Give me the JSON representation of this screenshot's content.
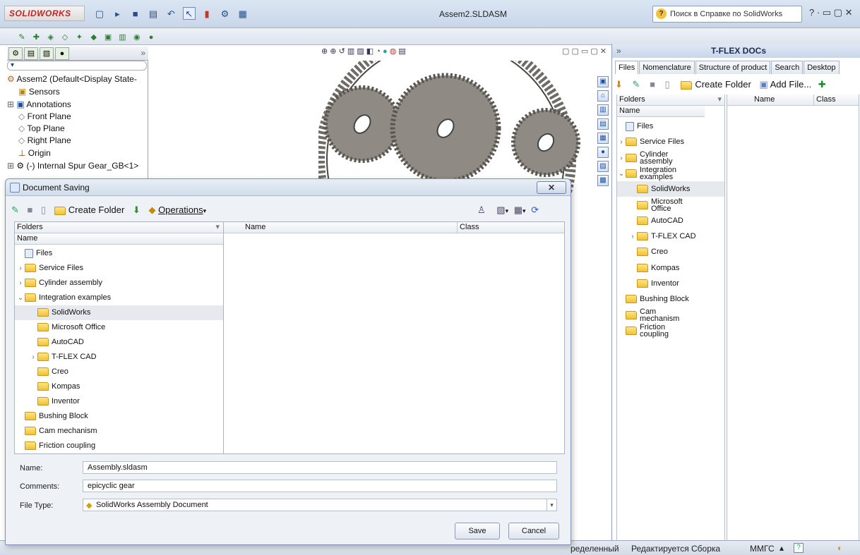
{
  "app": {
    "logo": "SOLIDWORKS",
    "document_title": "Assem2.SLDASM",
    "help_search_placeholder": "Поиск в Справке по SolidWorks",
    "window_controls": "? · ▭ ▢ ✕"
  },
  "toolbar": {
    "icons": [
      "new-icon",
      "open-icon",
      "save-icon",
      "print-icon",
      "undo-icon",
      "select-icon",
      "rebuild-icon",
      "options-icon",
      "view-icon"
    ],
    "row2_icons": [
      "mate-icon",
      "component-icon",
      "pattern-icon",
      "move-icon",
      "explode-icon",
      "assembly-feature-icon",
      "reference-icon",
      "bom-icon",
      "snapshot-icon",
      "check-icon"
    ]
  },
  "tree": {
    "root": "Assem2  (Default<Display State-",
    "items": [
      {
        "label": "Sensors",
        "icon": "sensor-icon"
      },
      {
        "label": "Annotations",
        "icon": "annotation-icon"
      },
      {
        "label": "Front Plane",
        "icon": "plane-icon"
      },
      {
        "label": "Top Plane",
        "icon": "plane-icon"
      },
      {
        "label": "Right Plane",
        "icon": "plane-icon"
      },
      {
        "label": "Origin",
        "icon": "origin-icon"
      },
      {
        "label": "(-) Internal Spur Gear_GB<1>",
        "icon": "part-icon"
      }
    ]
  },
  "dialog": {
    "title": "Document Saving",
    "close": "✕",
    "toolbar": {
      "create_folder": "Create Folder",
      "operations": "Operations"
    },
    "folders_header": "Folders",
    "name_header": "Name",
    "list_headers": {
      "name": "Name",
      "class": "Class"
    },
    "folders": [
      {
        "label": "Files",
        "level": 0,
        "expander": "",
        "root": true
      },
      {
        "label": "Service Files",
        "level": 0,
        "expander": "›"
      },
      {
        "label": "Cylinder assembly",
        "level": 0,
        "expander": "›"
      },
      {
        "label": "Integration examples",
        "level": 0,
        "expander": "⌄"
      },
      {
        "label": "SolidWorks",
        "level": 1,
        "expander": "",
        "selected": true
      },
      {
        "label": "Microsoft Office",
        "level": 1,
        "expander": ""
      },
      {
        "label": "AutoCAD",
        "level": 1,
        "expander": ""
      },
      {
        "label": "T-FLEX CAD",
        "level": 1,
        "expander": "›"
      },
      {
        "label": "Creo",
        "level": 1,
        "expander": ""
      },
      {
        "label": "Kompas",
        "level": 1,
        "expander": ""
      },
      {
        "label": "Inventor",
        "level": 1,
        "expander": ""
      },
      {
        "label": "Bushing Block",
        "level": 0,
        "expander": ""
      },
      {
        "label": "Cam mechanism",
        "level": 0,
        "expander": ""
      },
      {
        "label": "Friction coupling",
        "level": 0,
        "expander": ""
      }
    ],
    "form": {
      "name_label": "Name:",
      "name_value": "Assembly.sldasm",
      "comments_label": "Comments:",
      "comments_value": "epicyclic gear",
      "filetype_label": "File Type:",
      "filetype_value": "SolidWorks Assembly Document"
    },
    "buttons": {
      "save": "Save",
      "cancel": "Cancel"
    }
  },
  "tflex": {
    "title": "T-FLEX DOCs",
    "tabs": [
      "Files",
      "Nomenclature",
      "Structure of product",
      "Search",
      "Desktop"
    ],
    "toolbar": {
      "create_folder": "Create Folder",
      "add_file": "Add File..."
    },
    "folders_header": "Folders",
    "name_header": "Name",
    "list_headers": {
      "name": "Name",
      "class": "Class"
    },
    "folders": [
      {
        "label": "Files",
        "level": 0,
        "expander": "",
        "root": true
      },
      {
        "label": "Service Files",
        "level": 0,
        "expander": "›"
      },
      {
        "label": "Cylinder assembly",
        "level": 0,
        "expander": "›"
      },
      {
        "label": "Integration examples",
        "level": 0,
        "expander": "⌄"
      },
      {
        "label": "SolidWorks",
        "level": 1,
        "expander": "",
        "selected": true
      },
      {
        "label": "Microsoft Office",
        "level": 1,
        "expander": ""
      },
      {
        "label": "AutoCAD",
        "level": 1,
        "expander": ""
      },
      {
        "label": "T-FLEX CAD",
        "level": 1,
        "expander": "›"
      },
      {
        "label": "Creo",
        "level": 1,
        "expander": ""
      },
      {
        "label": "Kompas",
        "level": 1,
        "expander": ""
      },
      {
        "label": "Inventor",
        "level": 1,
        "expander": ""
      },
      {
        "label": "Bushing Block",
        "level": 0,
        "expander": ""
      },
      {
        "label": "Cam mechanism",
        "level": 0,
        "expander": ""
      },
      {
        "label": "Friction coupling",
        "level": 0,
        "expander": ""
      }
    ]
  },
  "status": {
    "state": "ределенный",
    "mode": "Редактируется Сборка",
    "units": "ММГС"
  }
}
